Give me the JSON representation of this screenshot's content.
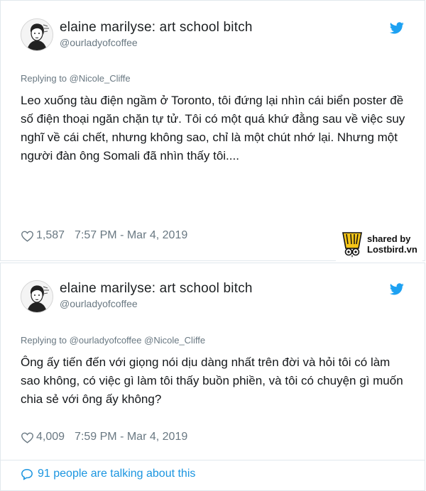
{
  "colors": {
    "twitter_blue": "#1da1f2",
    "link_blue": "#1b95e0",
    "muted_gray": "#697882",
    "text_dark": "#14171a"
  },
  "tweets": [
    {
      "display_name": "elaine marilyse: art school bitch",
      "handle": "@ourladyofcoffee",
      "replying_to": "Replying to @Nicole_Cliffe",
      "text": "Leo xuống tàu điện ngầm ở Toronto, tôi đứng lại nhìn cái biển poster đề số điện thoại ngăn chặn tự tử. Tôi có một quá khứ đằng sau về việc suy nghĩ về cái chết, nhưng không sao, chỉ là một chút nhớ lại. Nhưng một người đàn ông Somali đã nhìn thấy tôi....",
      "likes": "1,587",
      "time": "7:57 PM - Mar 4, 2019",
      "icons": [
        "avatar",
        "twitter-bird-icon",
        "heart-icon"
      ]
    },
    {
      "display_name": "elaine marilyse: art school bitch",
      "handle": "@ourladyofcoffee",
      "replying_to": "Replying to @ourladyofcoffee @Nicole_Cliffe",
      "text": "Ông ấy tiến đến với giọng nói dịu dàng nhất trên đời và hỏi tôi có làm sao không, có việc gì làm tôi thấy buồn phiền, và tôi có chuyện gì muốn chia sẻ với ông ấy không?",
      "likes": "4,009",
      "time": "7:59 PM - Mar 4, 2019",
      "talking": "91 people are talking about this",
      "icons": [
        "avatar",
        "twitter-bird-icon",
        "heart-icon",
        "comment-bubble-icon"
      ]
    }
  ],
  "watermark": {
    "line1": "shared by",
    "line2": "Lostbird.vn",
    "icon": "lostbird-logo-icon"
  }
}
